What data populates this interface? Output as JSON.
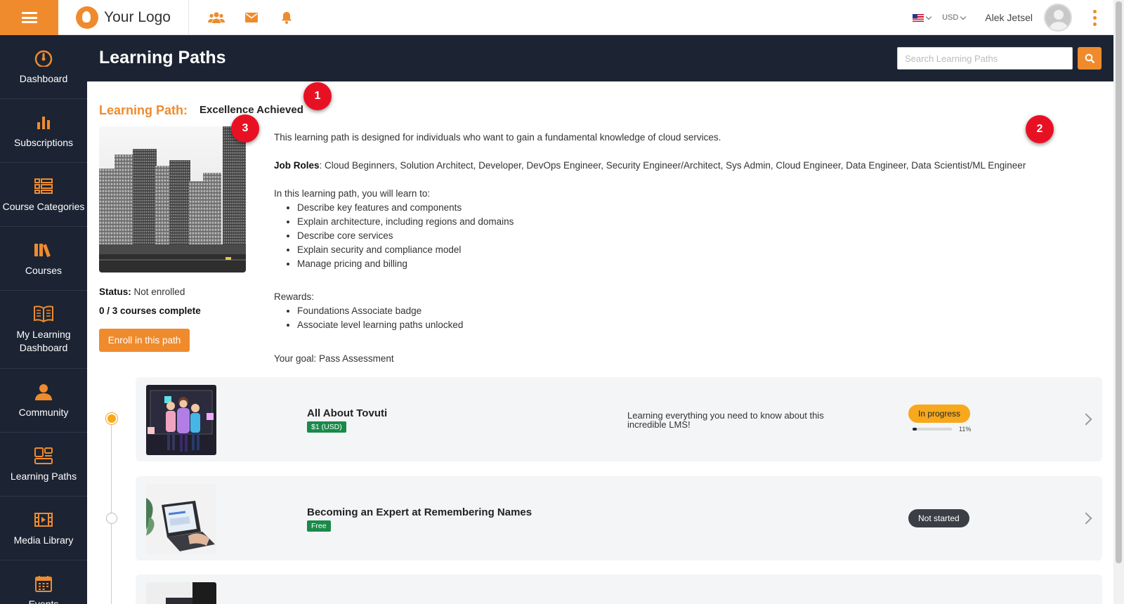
{
  "app": {
    "logo_text": "Your Logo",
    "currency": "USD",
    "user_name": "Alek Jetsel",
    "brand_color": "#ef8b2d",
    "nav_dark": "#1c2433"
  },
  "topbar_icons": [
    "community-icon",
    "mail-icon",
    "bell-icon"
  ],
  "sidebar": {
    "items": [
      {
        "label": "Dashboard",
        "icon": "speedometer-icon"
      },
      {
        "label": "Subscriptions",
        "icon": "bar-chart-icon"
      },
      {
        "label": "Course Categories",
        "icon": "list-icon"
      },
      {
        "label": "Courses",
        "icon": "books-icon"
      },
      {
        "label": "My Learning Dashboard",
        "icon": "open-book-icon"
      },
      {
        "label": "Community",
        "icon": "person-icon"
      },
      {
        "label": "Learning Paths",
        "icon": "layout-icon"
      },
      {
        "label": "Media Library",
        "icon": "film-icon"
      },
      {
        "label": "Events",
        "icon": "calendar-icon"
      }
    ]
  },
  "header": {
    "title": "Learning Paths",
    "search_placeholder": "Search Learning Paths"
  },
  "path": {
    "label": "Learning Path:",
    "name": "Excellence Achieved",
    "status_label": "Status:",
    "status_value": "Not enrolled",
    "progress": "0 / 3 courses complete",
    "enroll_label": "Enroll in this path",
    "intro": "This learning path is designed for individuals who want to gain a fundamental knowledge of cloud services.",
    "job_roles_label": "Job Roles",
    "job_roles": ": Cloud Beginners, Solution Architect, Developer, DevOps Engineer, Security Engineer/Architect, Sys Admin, Cloud Engineer, Data Engineer, Data Scientist/ML Engineer",
    "learn_intro": "In this learning path, you will learn to:",
    "learn_items": [
      "Describe key features and components",
      "Explain architecture, including regions and domains",
      "Describe core services",
      "Explain security and compliance model",
      "Manage pricing and billing"
    ],
    "rewards_label": "Rewards:",
    "rewards": [
      "Foundations Associate badge",
      "Associate level learning paths unlocked"
    ],
    "goal": "Your goal: Pass Assessment"
  },
  "markers": [
    "1",
    "2",
    "3"
  ],
  "courses": [
    {
      "title": "All About Tovuti",
      "price": "$1 (USD)",
      "description": "Learning everything you need to know about this incredible LMS!",
      "status": "In progress",
      "progress_pct": 11,
      "progress_label": "11%"
    },
    {
      "title": "Becoming an Expert at Remembering Names",
      "price": "Free",
      "description": "",
      "status": "Not started"
    }
  ]
}
